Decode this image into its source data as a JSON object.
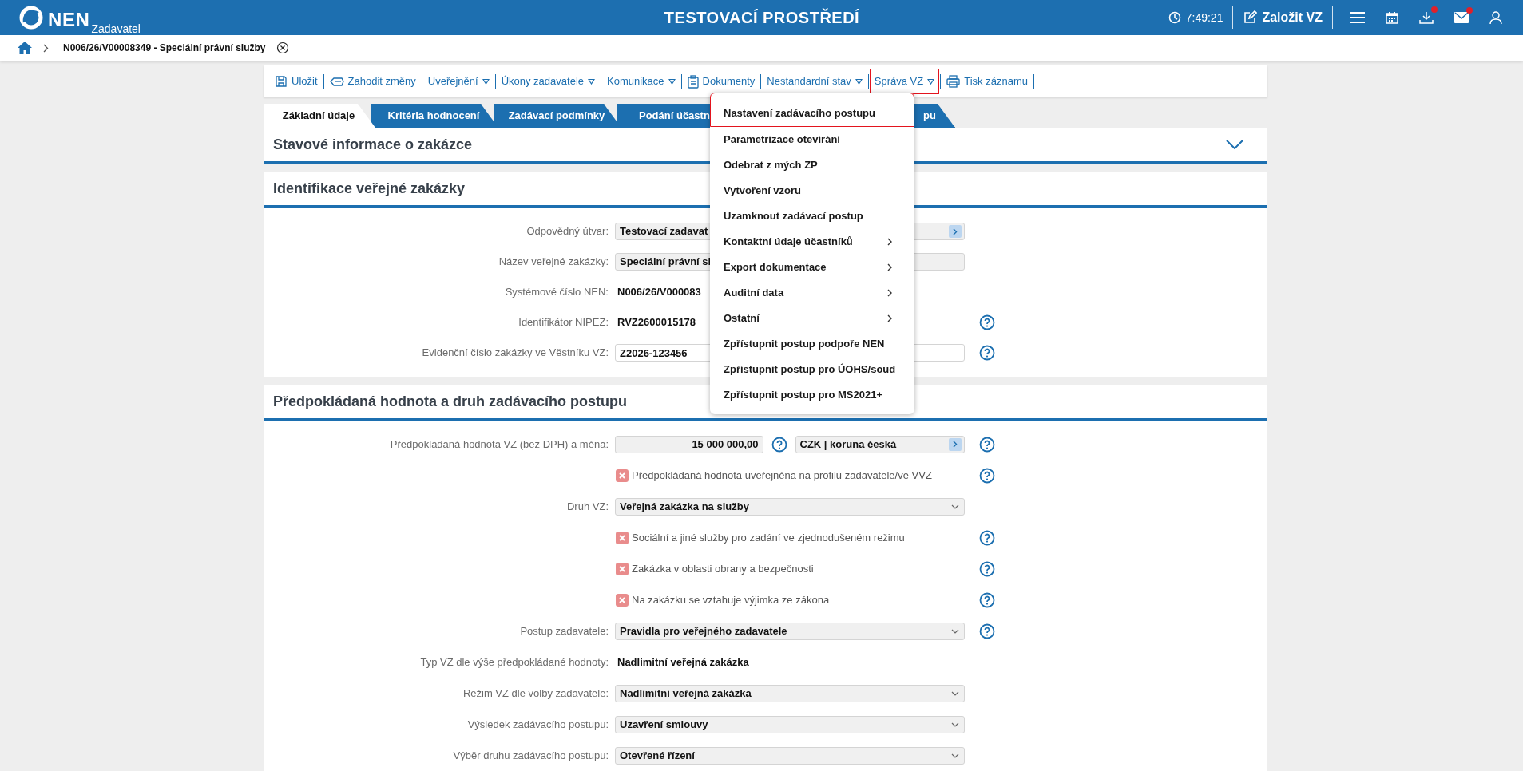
{
  "header": {
    "logo_text": "NEN",
    "logo_subtitle": "Zadavatel",
    "environment": "TESTOVACÍ PROSTŘEDÍ",
    "time": "7:49:21",
    "create_button": "Založit VZ",
    "download_badge": true,
    "mail_badge": true
  },
  "breadcrumb": {
    "items": [
      "N006/26/V00008349 - Speciální právní služby"
    ]
  },
  "toolbar": [
    {
      "label": "Uložit",
      "kind": "save",
      "selected": false
    },
    {
      "label": "Zahodit změny",
      "kind": "discard",
      "selected": false
    },
    {
      "label": "Uveřejnění",
      "kind": "menu",
      "selected": false
    },
    {
      "label": "Úkony zadavatele",
      "kind": "menu",
      "selected": false
    },
    {
      "label": "Komunikace",
      "kind": "menu",
      "selected": false
    },
    {
      "label": "Dokumenty",
      "kind": "documents",
      "selected": false
    },
    {
      "label": "Nestandardní stav",
      "kind": "menu",
      "selected": false
    },
    {
      "label": "Správa VZ",
      "kind": "menu",
      "selected": true
    },
    {
      "label": "Tisk záznamu",
      "kind": "print",
      "selected": false
    }
  ],
  "tabs": [
    {
      "label": "Základní údaje",
      "selected": true
    },
    {
      "label": "Kritéria hodnocení",
      "selected": false
    },
    {
      "label": "Zadávací podmínky",
      "selected": false
    },
    {
      "label": "Podání účastn",
      "selected": false
    },
    {
      "label": "pu",
      "selected": false
    }
  ],
  "menu": {
    "items": [
      {
        "label": "Nastavení zadávacího postupu",
        "selected": true,
        "has_submenu": false
      },
      {
        "label": "Parametrizace otevírání",
        "selected": false,
        "has_submenu": false
      },
      {
        "label": "Odebrat z mých ZP",
        "selected": false,
        "has_submenu": false
      },
      {
        "label": "Vytvoření vzoru",
        "selected": false,
        "has_submenu": false
      },
      {
        "label": "Uzamknout zadávací postup",
        "selected": false,
        "has_submenu": false
      },
      {
        "label": "Kontaktní údaje účastníků",
        "selected": false,
        "has_submenu": true
      },
      {
        "label": "Export dokumentace",
        "selected": false,
        "has_submenu": true
      },
      {
        "label": "Auditní data",
        "selected": false,
        "has_submenu": true
      },
      {
        "label": "Ostatní",
        "selected": false,
        "has_submenu": true
      },
      {
        "label": "Zpřístupnit postup podpoře NEN",
        "selected": false,
        "has_submenu": false
      },
      {
        "label": "Zpřístupnit postup pro ÚOHS/soud",
        "selected": false,
        "has_submenu": false
      },
      {
        "label": "Zpřístupnit postup pro MS2021+",
        "selected": false,
        "has_submenu": false
      }
    ]
  },
  "sections": [
    {
      "title": "Stavové informace o zakázce",
      "expanded": false
    },
    {
      "title": "Identifikace veřejné zakázky",
      "expanded": true,
      "rows": [
        {
          "kind": "picker",
          "label": "Odpovědný útvar:",
          "value": "Testovací zadavat",
          "help": false
        },
        {
          "kind": "readonly",
          "label": "Název veřejné zakázky:",
          "value": "Speciální právní sl",
          "help": false
        },
        {
          "kind": "static",
          "label": "Systémové číslo NEN:",
          "value": "N006/26/V000083",
          "help": false
        },
        {
          "kind": "static",
          "label": "Identifikátor NIPEZ:",
          "value": "RVZ2600015178",
          "help": true
        },
        {
          "kind": "input",
          "label": "Evidenční číslo zakázky ve Věstníku VZ:",
          "value": "Z2026-123456",
          "help": true
        }
      ]
    },
    {
      "title": "Předpokládaná hodnota a druh zadávacího postupu",
      "expanded": true,
      "rows": [
        {
          "kind": "money",
          "label": "Předpokládaná hodnota VZ (bez DPH) a měna:",
          "value": "15 000 000,00",
          "currency": "CZK | koruna česká",
          "help": true
        },
        {
          "kind": "checkbox",
          "text": "Předpokládaná hodnota uveřejněna na profilu zadavatele/ve VVZ",
          "checked": false,
          "help": true
        },
        {
          "kind": "select",
          "label": "Druh VZ:",
          "value": "Veřejná zakázka na služby",
          "help": false
        },
        {
          "kind": "checkbox",
          "text": "Sociální a jiné služby pro zadání ve zjednodušeném režimu",
          "checked": false,
          "help": true
        },
        {
          "kind": "checkbox",
          "text": "Zakázka v oblasti obrany a bezpečnosti",
          "checked": false,
          "help": true
        },
        {
          "kind": "checkbox",
          "text": "Na zakázku se vztahuje výjimka ze zákona",
          "checked": false,
          "help": true
        },
        {
          "kind": "select",
          "label": "Postup zadavatele:",
          "value": "Pravidla pro veřejného zadavatele",
          "help": true
        },
        {
          "kind": "static",
          "label": "Typ VZ dle výše předpokládané hodnoty:",
          "value": "Nadlimitní veřejná zakázka",
          "help": false
        },
        {
          "kind": "select",
          "label": "Režim VZ dle volby zadavatele:",
          "value": "Nadlimitní veřejná zakázka",
          "help": false
        },
        {
          "kind": "select",
          "label": "Výsledek zadávacího postupu:",
          "value": "Uzavření smlouvy",
          "help": false
        },
        {
          "kind": "select",
          "label": "Výběr druhu zadávacího postupu:",
          "value": "Otevřené řízení",
          "help": false
        }
      ]
    }
  ]
}
